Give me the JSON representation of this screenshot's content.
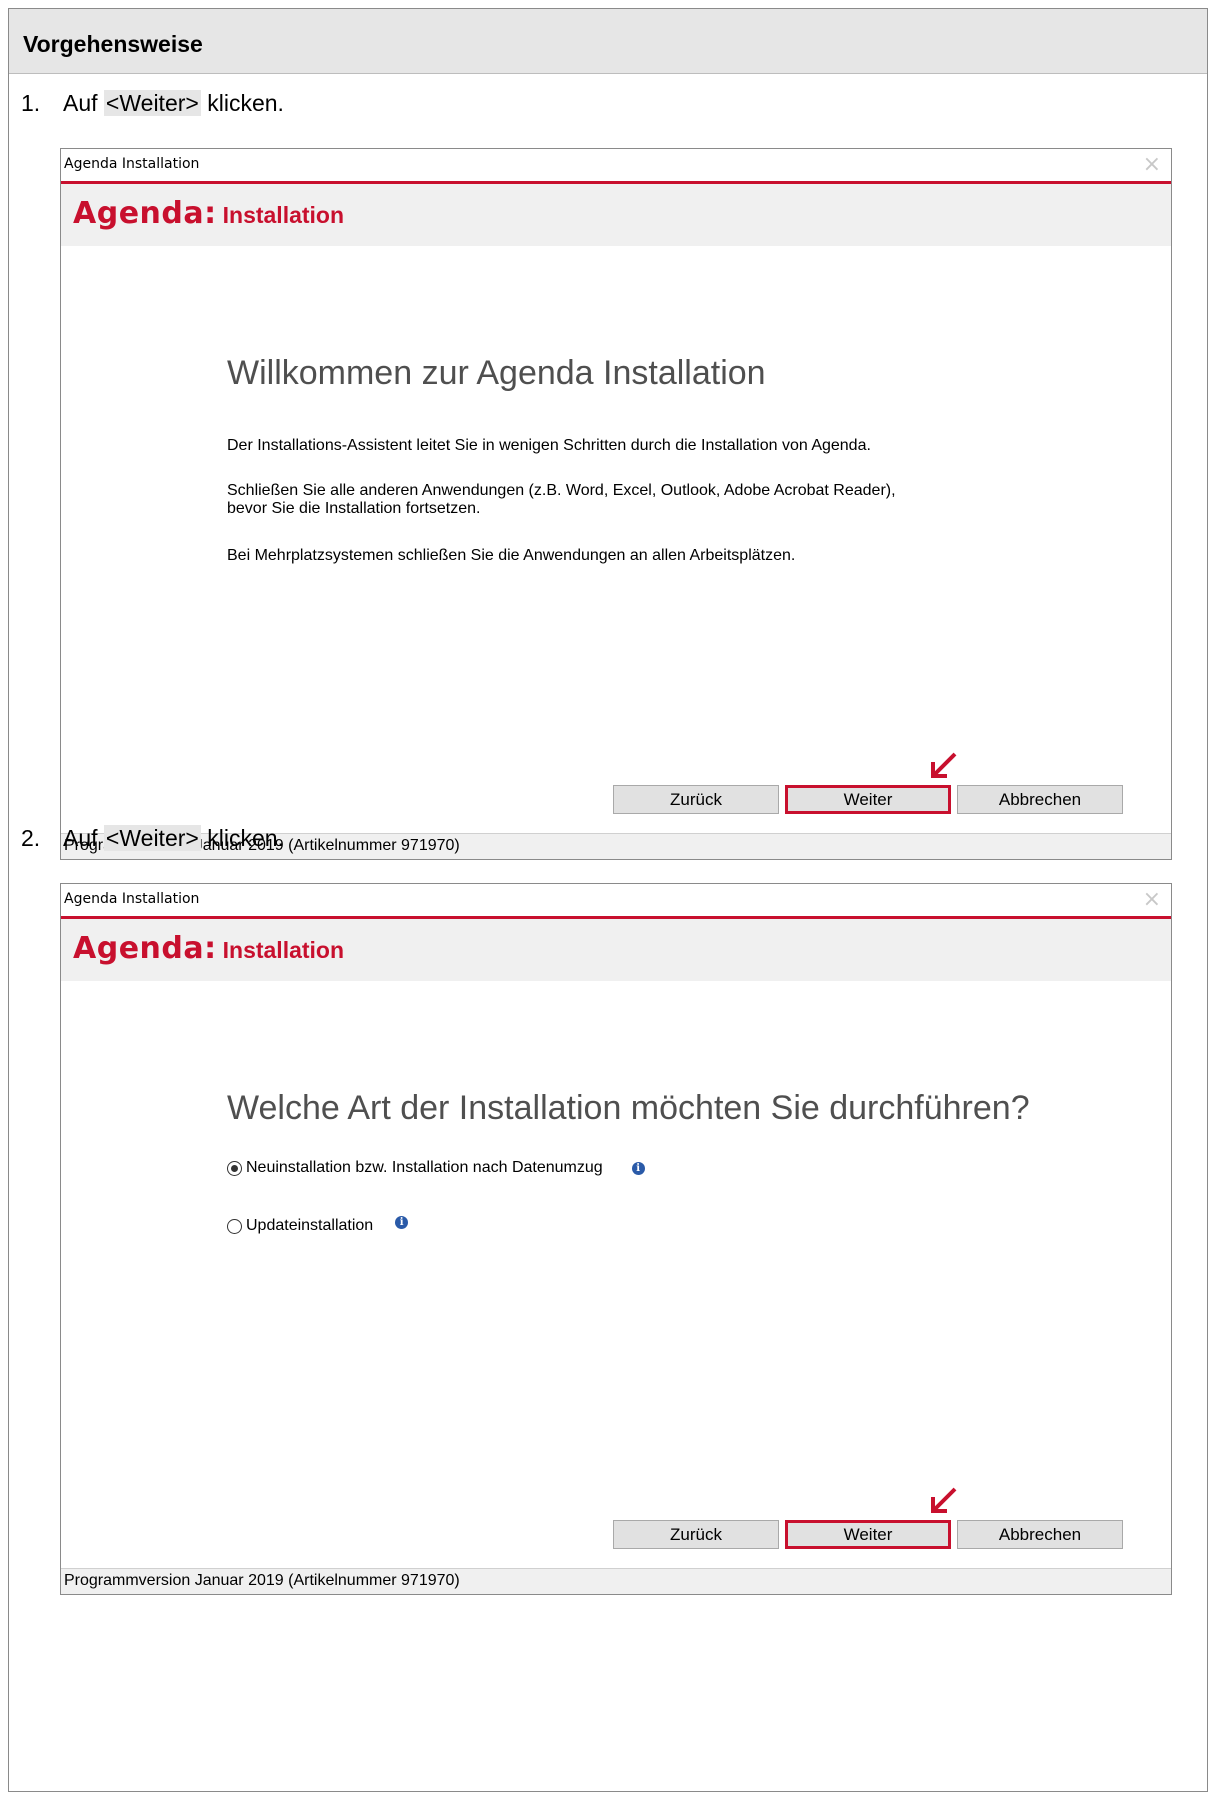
{
  "section": {
    "title": "Vorgehensweise"
  },
  "steps": [
    {
      "number": "1.",
      "prefix": "Auf ",
      "highlight": "<Weiter>",
      "suffix": " klicken.",
      "window": {
        "title": "Agenda Installation",
        "close": "×",
        "brand_logo": "Agenda:",
        "brand_product": "Installation",
        "heading": "Willkommen zur Agenda Installation",
        "paragraphs": [
          "Der Installations-Assistent leitet Sie in wenigen Schritten durch die Installation von Agenda.",
          "Schließen Sie alle anderen Anwendungen (z.B. Word, Excel, Outlook, Adobe Acrobat Reader),",
          "bevor Sie die Installation fortsetzen.",
          "Bei Mehrplatzsystemen schließen Sie die Anwendungen an allen Arbeitsplätzen."
        ],
        "buttons": {
          "back": "Zurück",
          "next": "Weiter",
          "cancel": "Abbrechen"
        },
        "status": "Programmversion Januar 2019 (Artikelnummer 971970)"
      }
    },
    {
      "number": "2.",
      "prefix": "Auf ",
      "highlight": "<Weiter>",
      "suffix": " klicken.",
      "window": {
        "title": "Agenda Installation",
        "close": "×",
        "brand_logo": "Agenda:",
        "brand_product": "Installation",
        "heading": "Welche Art der Installation möchten Sie durchführen?",
        "options": [
          {
            "label": "Neuinstallation bzw. Installation nach Datenumzug",
            "selected": true,
            "info": "i"
          },
          {
            "label": "Updateinstallation",
            "selected": false,
            "info": "i"
          }
        ],
        "buttons": {
          "back": "Zurück",
          "next": "Weiter",
          "cancel": "Abbrechen"
        },
        "status": "Programmversion Januar 2019 (Artikelnummer 971970)"
      }
    }
  ],
  "colors": {
    "accent": "#c8102e",
    "header_bg": "#e6e6e6",
    "info_icon": "#2a5aa8"
  }
}
